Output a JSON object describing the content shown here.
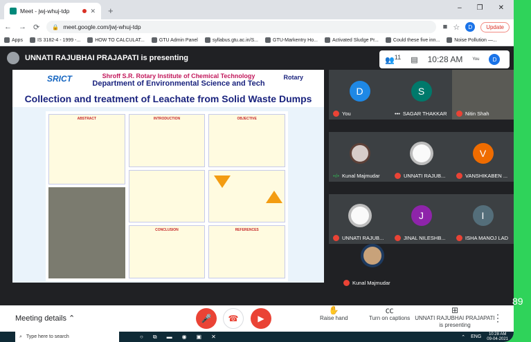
{
  "browser": {
    "tab_title": "Meet - jwj-whuj-tdp",
    "new_tab_symbol": "+",
    "window_controls": [
      "–",
      "❐",
      "✕"
    ],
    "url": "meet.google.com/jwj-whuj-tdp",
    "profile_initial": "D",
    "update_label": "Update",
    "bookmarks": [
      "Apps",
      "IS 3182-4 - 1999 -...",
      "HOW TO CALCULAT...",
      "GTU Admin Panel",
      "syllabus.gtu.ac.in/S...",
      "GTU-Markentry Ho...",
      "Activated Sludge Pr...",
      "Could these five inn...",
      "Noise Pollution —..."
    ]
  },
  "meet": {
    "presenting_banner": "UNNATI RAJUBHAI PRAJAPATI is presenting",
    "participant_count": "11",
    "time": "10:28 AM",
    "you_label": "You",
    "self_initial": "D",
    "tiles": [
      {
        "name": "You",
        "initial": "D",
        "color": "#1e88e5"
      },
      {
        "name": "SAGAR THAKKAR",
        "initial": "S",
        "color": "#00796b"
      },
      {
        "name": "Nitin Shah",
        "initial": "",
        "color": ""
      },
      {
        "name": "Kunal Majmudar",
        "initial": "",
        "color": ""
      },
      {
        "name": "UNNATI RAJUB...",
        "initial": "",
        "color": ""
      },
      {
        "name": "VANSHIKABEN ...",
        "initial": "V",
        "color": "#ef6c00"
      },
      {
        "name": "UNNATI RAJUB...",
        "initial": "",
        "color": ""
      },
      {
        "name": "JINAL NILESHB...",
        "initial": "J",
        "color": "#8e24aa"
      },
      {
        "name": "ISHA MANOJ LAD",
        "initial": "I",
        "color": "#546e7a"
      }
    ],
    "self_view_name": "Kunal Majmudar",
    "meeting_details": "Meeting details",
    "raise_hand": "Raise hand",
    "captions": "Turn on captions",
    "presenting_label_1": "UNNATI RAJUBHAI PRAJAPATI",
    "presenting_label_2": "is presenting",
    "more_options": "⋮"
  },
  "slide": {
    "logo_text": "SRICT",
    "institute": "Shroff S.R. Rotary Institute of Chemical Technology",
    "department": "Department of Environmental Science and Tech",
    "rotary": "Rotary",
    "title": "Collection and treatment of Leachate from Solid Waste Dumps",
    "sections": {
      "abstract": "ABSTRACT",
      "introduction": "INTRODUCTION",
      "objective": "OBJECTIVE",
      "conclusion": "CONCLUSION",
      "references": "REFERENCES"
    }
  },
  "overlay_number": "89",
  "taskbar": {
    "search_placeholder": "Type here to search",
    "tray_time": "10:28 AM",
    "tray_date": "09-04-2021",
    "lang": "ENG"
  }
}
